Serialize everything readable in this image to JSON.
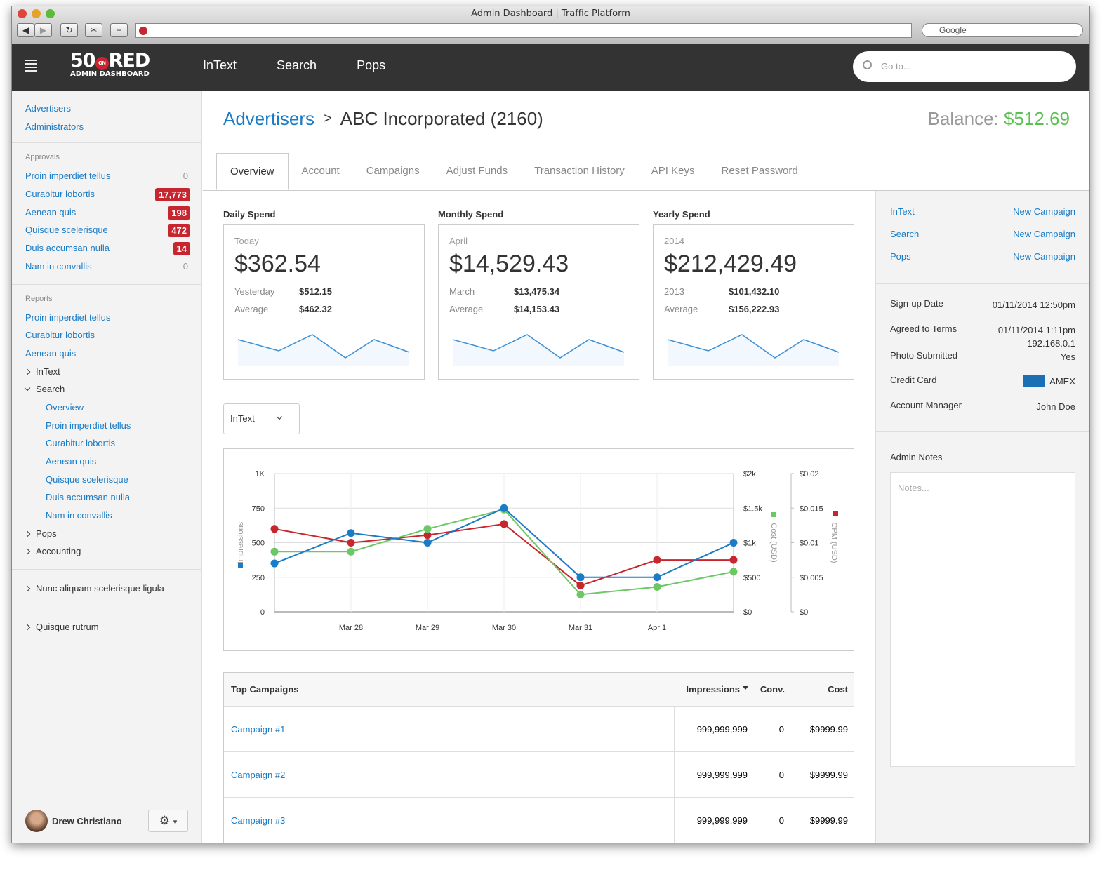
{
  "browser": {
    "title": "Admin Dashboard  |  Traffic Platform",
    "search_placeholder": "Google"
  },
  "topnav": {
    "logo_top": "50RED",
    "logo_badge": "ON",
    "logo_bottom": "ADMIN DASHBOARD",
    "links": [
      "InText",
      "Search",
      "Pops"
    ],
    "goto_placeholder": "Go to..."
  },
  "sidebar": {
    "top": [
      "Advertisers",
      "Administrators"
    ],
    "approvals_label": "Approvals",
    "approvals": [
      {
        "label": "Proin imperdiet tellus",
        "count": "0",
        "badge": false
      },
      {
        "label": "Curabitur lobortis",
        "count": "17,773",
        "badge": true
      },
      {
        "label": "Aenean quis",
        "count": "198",
        "badge": true
      },
      {
        "label": "Quisque scelerisque",
        "count": "472",
        "badge": true
      },
      {
        "label": "Duis accumsan nulla",
        "count": "14",
        "badge": true
      },
      {
        "label": "Nam in convallis",
        "count": "0",
        "badge": false
      }
    ],
    "reports_label": "Reports",
    "reports": [
      "Proin imperdiet tellus",
      "Curabitur lobortis",
      "Aenean quis"
    ],
    "intext": "InText",
    "search": "Search",
    "search_sub": [
      "Overview",
      "Proin imperdiet tellus",
      "Curabitur lobortis",
      "Aenean quis",
      "Quisque scelerisque",
      "Duis accumsan nulla",
      "Nam in convallis"
    ],
    "pops": "Pops",
    "accounting": "Accounting",
    "extra1": "Nunc aliquam scelerisque ligula",
    "extra2": "Quisque rutrum",
    "user": "Drew Christiano"
  },
  "header": {
    "crumb_root": "Advertisers",
    "crumb_current": "ABC Incorporated (2160)",
    "balance_label": "Balance:",
    "balance": "$512.69"
  },
  "tabs": [
    "Overview",
    "Account",
    "Campaigns",
    "Adjust Funds",
    "Transaction History",
    "API Keys",
    "Reset Password"
  ],
  "spend": [
    {
      "title": "Daily Spend",
      "period": "Today",
      "amount": "$362.54",
      "prev_label": "Yesterday",
      "prev": "$512.15",
      "avg_label": "Average",
      "avg": "$462.32"
    },
    {
      "title": "Monthly Spend",
      "period": "April",
      "amount": "$14,529.43",
      "prev_label": "March",
      "prev": "$13,475.34",
      "avg_label": "Average",
      "avg": "$14,153.43"
    },
    {
      "title": "Yearly Spend",
      "period": "2014",
      "amount": "$212,429.49",
      "prev_label": "2013",
      "prev": "$101,432.10",
      "avg_label": "Average",
      "avg": "$156,222.93"
    }
  ],
  "filter": {
    "selected": "InText"
  },
  "chart_data": {
    "type": "line",
    "categories": [
      "",
      "Mar 28",
      "Mar 29",
      "Mar 30",
      "Mar 31",
      "Apr 1",
      ""
    ],
    "axes": {
      "left": {
        "label": "Impressions",
        "ticks": [
          "0",
          "250",
          "500",
          "750",
          "1K"
        ],
        "range": [
          0,
          1000
        ]
      },
      "right1": {
        "label": "Cost (USD)",
        "ticks": [
          "$0",
          "$500",
          "$1k",
          "$1.5k",
          "$2k"
        ],
        "range": [
          0,
          2000
        ]
      },
      "right2": {
        "label": "CPM (USD)",
        "ticks": [
          "$0",
          "$0.005",
          "$0.01",
          "$0.015",
          "$0.02"
        ],
        "range": [
          0,
          0.02
        ]
      }
    },
    "grid": true,
    "series": [
      {
        "name": "Impressions",
        "axis": "left",
        "color": "#1a7bc6",
        "values": [
          350,
          570,
          500,
          750,
          250,
          250,
          500
        ]
      },
      {
        "name": "Cost (USD)",
        "axis": "right1",
        "color": "#6cc765",
        "values": [
          870,
          870,
          1200,
          1480,
          250,
          360,
          580
        ]
      },
      {
        "name": "CPM (USD)",
        "axis": "right2",
        "color": "#c8262f",
        "values": [
          0.012,
          0.01,
          0.0111,
          0.0127,
          0.0038,
          0.0075,
          0.0075
        ]
      }
    ]
  },
  "campaigns": {
    "headers": [
      "Top Campaigns",
      "Impressions",
      "Conv.",
      "Cost"
    ],
    "rows": [
      [
        "Campaign #1",
        "999,999,999",
        "0",
        "$9999.99"
      ],
      [
        "Campaign #2",
        "999,999,999",
        "0",
        "$9999.99"
      ],
      [
        "Campaign #3",
        "999,999,999",
        "0",
        "$9999.99"
      ]
    ]
  },
  "right": {
    "links": [
      {
        "name": "InText",
        "action": "New Campaign"
      },
      {
        "name": "Search",
        "action": "New Campaign"
      },
      {
        "name": "Pops",
        "action": "New Campaign"
      }
    ],
    "info": [
      {
        "k": "Sign-up Date",
        "v": "01/11/2014 12:50pm"
      },
      {
        "k": "Agreed to Terms",
        "v": "01/11/2014 1:11pm",
        "v2": "192.168.0.1"
      },
      {
        "k": "Photo Submitted",
        "v": "Yes"
      },
      {
        "k": "Credit Card",
        "v": "AMEX"
      },
      {
        "k": "Account Manager",
        "v": "John Doe"
      }
    ],
    "notes_label": "Admin Notes",
    "notes_placeholder": "Notes..."
  },
  "colors": {
    "accent": "#1a7bc6",
    "positive": "#5cbf52",
    "badge": "#c8262f",
    "nav": "#333333"
  }
}
